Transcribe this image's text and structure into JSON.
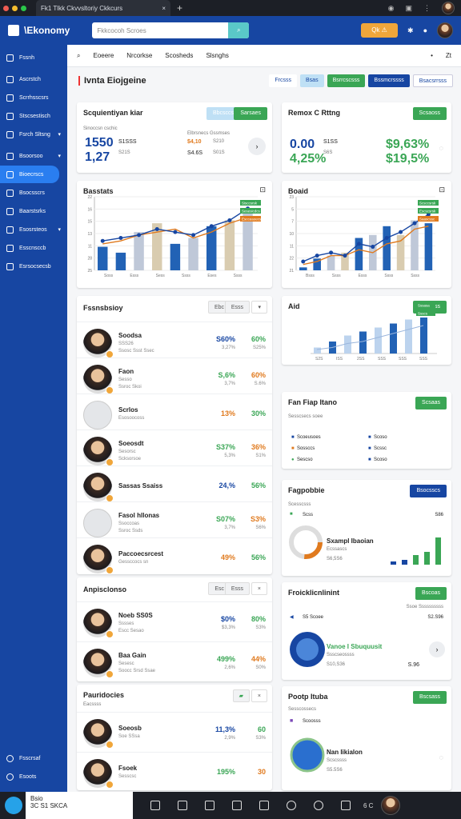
{
  "browser": {
    "tab_title": "Fk1 Tlkk Ckvvsltoriy Ckkcurs",
    "new_tab": "+",
    "close": "×"
  },
  "app": {
    "brand": "\\Ekonomy",
    "search_placeholder": "Fkkcocoh Scroes",
    "warn_label": "Qk"
  },
  "sidebar": {
    "items": [
      {
        "label": "Fssnh"
      },
      {
        "label": "Ascrstch"
      },
      {
        "label": "Scrrhsscsrs"
      },
      {
        "label": "Stscsestisch"
      },
      {
        "label": "Fsrch Sltsng"
      },
      {
        "label": "Bsoorsoo"
      },
      {
        "label": "Bioecrscs"
      },
      {
        "label": "Bsocsscrs"
      },
      {
        "label": "Baarstsrks"
      },
      {
        "label": "Esosrsteos"
      },
      {
        "label": "Esscnsccb"
      },
      {
        "label": "Esrsocsecsb"
      }
    ],
    "footer": [
      "Fsscrsaf",
      "Esoots"
    ]
  },
  "header": {
    "items": [
      "Eoeere",
      "Nrcorkse",
      "Scosheds",
      "Slsnghs"
    ],
    "right": [
      "•",
      "Zt"
    ]
  },
  "page": {
    "title": "Ivnta Eiojgeine",
    "buttons": [
      "Frcsss",
      "Bsas",
      "Bsrrcscsss",
      "Bssmcrssss",
      "Bsacsrrsss"
    ]
  },
  "kpi1": {
    "title": "Scquientiyan kiar",
    "btns": [
      "Bbcsccs",
      "Sarsaes"
    ],
    "sub1": "Sinoccsn cschic",
    "sub2": "Elbrsnecs Gssmses",
    "v1": "1550",
    "v2": "1,27",
    "p1": "S1SSS",
    "p2": "S21S",
    "p3": "$4,10",
    "p4": "S210",
    "p5": "S4.6S",
    "p6": "S01S"
  },
  "kpi2": {
    "title": "Remox C Rttng",
    "btn": "Scsaoss",
    "v1": "0.00",
    "v2": "4,25%",
    "v3": "$9,63%",
    "v4": "$19,5%",
    "s1": "S1SS",
    "s2": "S6S"
  },
  "chart1": {
    "title": "Basstats",
    "legend": [
      "Sisccsrsk",
      "Sesesicdcs",
      "Escceaoecs"
    ],
    "yticks": [
      "25",
      "28",
      "11",
      "13",
      "15",
      "16",
      "22"
    ],
    "xticks": [
      "Soss",
      "Esss",
      "Sess",
      "Ssss",
      "Eses",
      "Ssss"
    ]
  },
  "chart2": {
    "title": "Boaid",
    "legend": [
      "Scsccsrsk",
      "Escscsrsk",
      "Saascssc"
    ],
    "yticks": [
      "21",
      "22",
      "11",
      "10",
      "7",
      "5",
      "23"
    ],
    "xticks": [
      "Bsss",
      "Ssss",
      "Esss",
      "Ssss",
      "Ssss"
    ]
  },
  "list1": {
    "title": "Fssnsbsioy",
    "btns": [
      "Ebc",
      "Esss"
    ],
    "rows": [
      {
        "name": "Soodsa",
        "sub": "SSS26",
        "sub2": "Ssosc Ssst Ssec",
        "v1": "S60%",
        "s1": "3,27%",
        "v2": "60%",
        "s2": "S25%"
      },
      {
        "name": "Faon",
        "sub": "Sesso",
        "sub2": "Ssroc Skoi",
        "v1": "S,6%",
        "s1": "3,7%",
        "v2": "60%",
        "s2": "S.6%"
      },
      {
        "name": "Scrlos",
        "sub": "Esosoocoss",
        "sub2": "",
        "v1": "13%",
        "s1": "",
        "v2": "30%",
        "s2": ""
      },
      {
        "name": "Soeosdt",
        "sub": "Sesorsc",
        "sub2": "Scksorsoe",
        "v1": "S37%",
        "s1": "5,3%",
        "v2": "36%",
        "s2": "S1%"
      },
      {
        "name": "Sassas Ssaiss",
        "sub": "",
        "sub2": "",
        "v1": "24,%",
        "s1": "",
        "v2": "56%",
        "s2": ""
      },
      {
        "name": "Fasol hllonas",
        "sub": "Ssoccoas",
        "sub2": "Ssroc Ssds",
        "v1": "S07%",
        "s1": "3,7%",
        "v2": "S3%",
        "s2": "S6%"
      },
      {
        "name": "Paccoecsrcest",
        "sub": "Gessccocs sn",
        "sub2": "",
        "v1": "49%",
        "s1": "",
        "v2": "56%",
        "s2": ""
      }
    ]
  },
  "list2": {
    "title": "Anpisclonso",
    "btns": [
      "Esc",
      "Esss"
    ],
    "rows": [
      {
        "name": "Noeb SS0S",
        "sub": "Sssses",
        "sub2": "Escc Sesao",
        "v1": "$0%",
        "s1": "$3,3%",
        "v2": "80%",
        "s2": "S3%"
      },
      {
        "name": "Baa Gain",
        "sub": "Sesesc",
        "sub2": "Soocc Srsd Ssae",
        "v1": "499%",
        "s1": "2,6%",
        "v2": "44%",
        "s2": "S0%"
      }
    ]
  },
  "list3": {
    "title": "Pauridocies",
    "sub": "Eacssss",
    "rows": [
      {
        "name": "Soeosb",
        "sub": "Soe SSsa",
        "v1": "11,3%",
        "s1": "2,9%",
        "v2": "60",
        "s2": "S3%"
      },
      {
        "name": "Fsoek",
        "sub": "Sesscsc",
        "v1": "195%",
        "s1": "",
        "v2": "30",
        "s2": ""
      }
    ]
  },
  "card_aid": {
    "title": "Aid",
    "btn": "Bsssoss",
    "legend": [
      "Sssasa",
      "Ssscs"
    ],
    "xticks": [
      "S2S",
      "ISS",
      "2SS",
      "SSS",
      "SSS",
      "SSS"
    ]
  },
  "card_flap": {
    "title": "Fan Fiap Itano",
    "btn": "Scsaas",
    "sub": "Sesscsecs soee",
    "items": [
      "Scoeusoes",
      "Sossccs",
      "Sescso",
      "Scoso",
      "Scssc",
      "Scoso"
    ]
  },
  "card_progress": {
    "title": "Fagpobbie",
    "btn": "Bsocsscs",
    "sub": "Scesscsss",
    "l1": "Scss",
    "v1": "S86",
    "t1": "Sxampl Ibaoian",
    "t2": "Ecssascs",
    "t3": "S6,5S6"
  },
  "card_pred": {
    "title": "Froicklicnlinint",
    "btn": "Bscoas",
    "sub": "Ssoe Ssssssssss",
    "l1": "S5 Scoee",
    "v1": "S2.S96",
    "t1": "Vanoe I Sbuquusit",
    "t2": "Ssscseossss",
    "t3": "S10,S36",
    "t4": "S.96"
  },
  "card_pool": {
    "title": "Pootp Ituba",
    "btn": "Bscsass",
    "sub": "Sesscossecs",
    "l1": "Scoosss",
    "t1": "Nan Iikialon",
    "t2": "Scscssss",
    "t3": "S5.5S6"
  },
  "taskbar": {
    "line1": "Bsio",
    "line2": "3C S1 SKCA",
    "time": "6 C"
  },
  "colors": {
    "brand": "#1746a2",
    "green": "#3aa655",
    "orange": "#e07a1e",
    "gray": "#c9cdd4"
  },
  "chart_data": [
    {
      "type": "bar",
      "categories": [
        "1",
        "2",
        "3",
        "4",
        "5",
        "6",
        "7",
        "8",
        "9"
      ],
      "series": [
        {
          "values": [
            8,
            6,
            13,
            16,
            9,
            11,
            15,
            17,
            20
          ]
        },
        {
          "values": [
            9,
            10,
            12,
            13,
            14,
            11,
            13,
            16,
            18
          ]
        },
        {
          "values": [
            10,
            11,
            12,
            14,
            13,
            12,
            15,
            17,
            21
          ]
        }
      ],
      "ylim": [
        0,
        25
      ]
    },
    {
      "type": "bar",
      "categories": [
        "1",
        "2",
        "3",
        "4",
        "5",
        "6",
        "7",
        "8",
        "9",
        "10"
      ],
      "series": [
        {
          "values": [
            1,
            4,
            5,
            6,
            11,
            12,
            15,
            12,
            17,
            16
          ]
        },
        {
          "values": [
            2,
            3,
            5,
            5,
            7,
            6,
            9,
            10,
            14,
            15
          ]
        },
        {
          "values": [
            3,
            5,
            6,
            5,
            9,
            8,
            11,
            13,
            16,
            19
          ]
        }
      ],
      "ylim": [
        0,
        25
      ]
    },
    {
      "type": "bar",
      "categories": [
        "1",
        "2",
        "3",
        "4",
        "5",
        "6",
        "7",
        "8"
      ],
      "series": [
        {
          "values": [
            2,
            3,
            5,
            6,
            8,
            10,
            12,
            14
          ]
        },
        {
          "values": [
            3,
            6,
            9,
            11,
            13,
            15,
            17,
            18
          ]
        }
      ],
      "ylim": [
        0,
        20
      ]
    }
  ]
}
